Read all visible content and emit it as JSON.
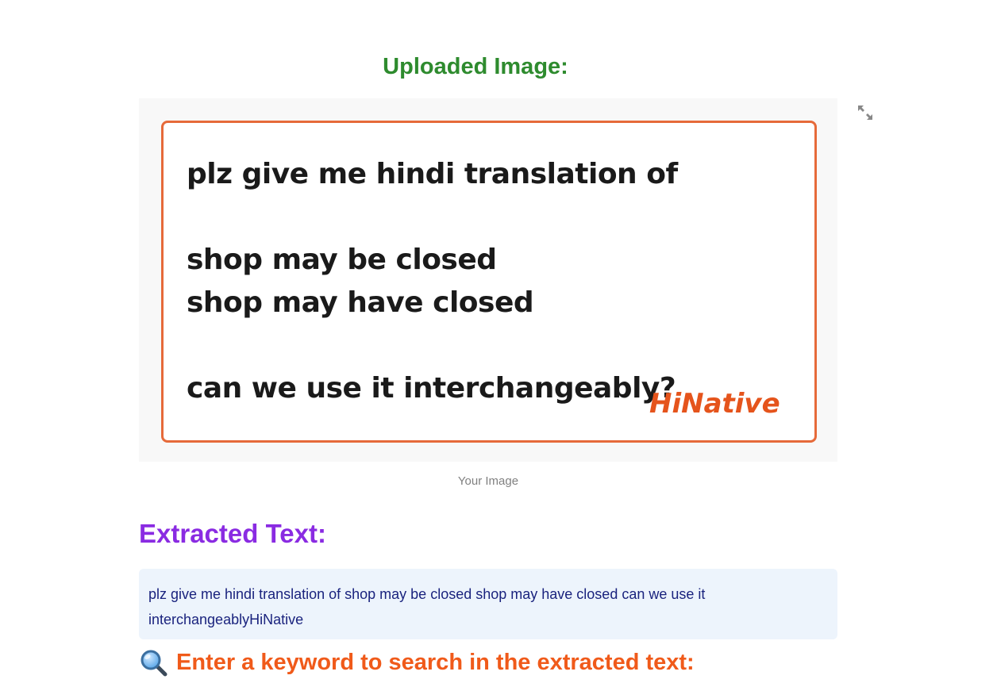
{
  "uploaded_section": {
    "heading": "Uploaded Image:",
    "caption": "Your Image"
  },
  "image_content": {
    "lines": [
      "plz give me hindi translation of",
      "shop may be closed",
      "shop may have closed",
      "can we use it interchangeably?"
    ],
    "logo_text": "HiNative",
    "border_color": "#e66a3a",
    "logo_color": "#e5541c"
  },
  "extracted_section": {
    "heading": "Extracted Text:",
    "text": "plz give me hindi translation of shop may be closed shop may have closed can we use it interchangeablyHiNative"
  },
  "search_section": {
    "heading": "Enter a keyword to search in the extracted text:",
    "icon": "magnifying-glass-icon"
  },
  "colors": {
    "uploaded_heading": "#2e8b2e",
    "extracted_heading": "#8a2be2",
    "search_heading": "#f05a1a",
    "text_box_bg": "#edf4fc",
    "text_box_fg": "#1a237e"
  }
}
